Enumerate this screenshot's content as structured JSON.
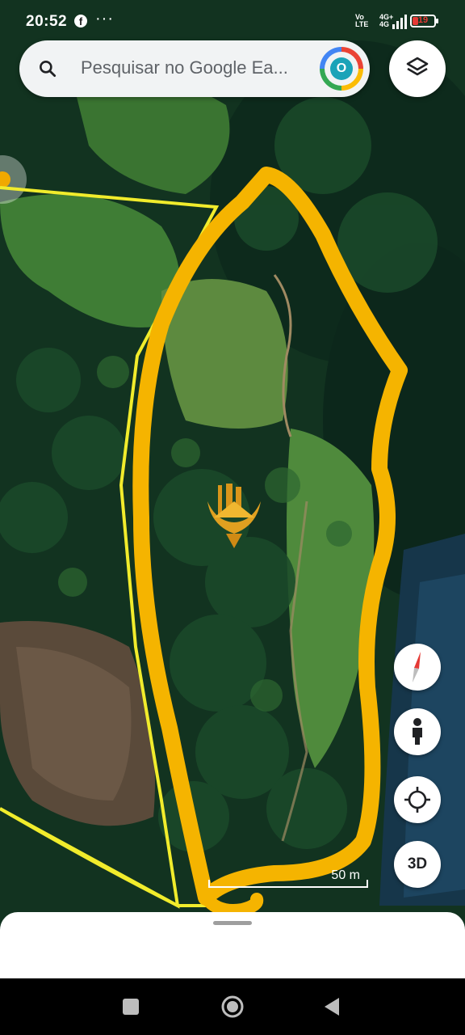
{
  "status_bar": {
    "time": "20:52",
    "facebook_icon": "facebook-icon",
    "more_dots": "···",
    "network_label_top": "Vo",
    "network_label_bottom": "LTE",
    "signal_label_top": "4G+",
    "signal_label_bottom": "4G",
    "battery_level": "19",
    "battery_color": "#e53935"
  },
  "search": {
    "placeholder": "Pesquisar no Google Ea...",
    "icon": "search-icon",
    "avatar_letter": "O"
  },
  "map": {
    "layers_icon": "layers-icon",
    "outline_color": "#f5b400",
    "parcel_line_color": "#f1ec2c",
    "logo": "gold-building-eagle-logo",
    "scale_label": "50 m"
  },
  "controls": {
    "compass_icon": "compass-icon",
    "street_view_icon": "pegman-icon",
    "my_location_icon": "my-location-icon",
    "three_d_label": "3D"
  },
  "nav_bar": {
    "recents_icon": "square-icon",
    "home_icon": "circle-icon",
    "back_icon": "triangle-back-icon"
  }
}
